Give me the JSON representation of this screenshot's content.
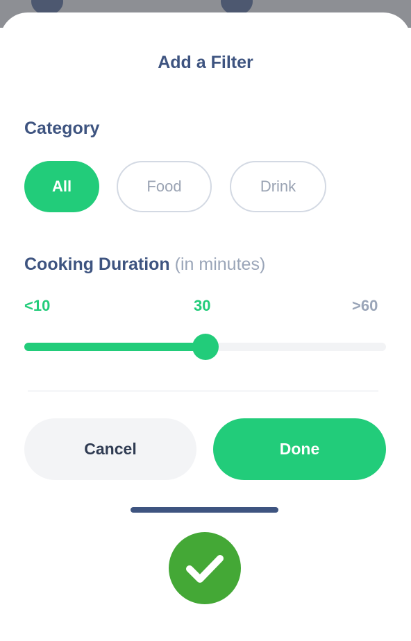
{
  "title": "Add a Filter",
  "category": {
    "label": "Category",
    "options": [
      {
        "label": "All",
        "selected": true
      },
      {
        "label": "Food",
        "selected": false
      },
      {
        "label": "Drink",
        "selected": false
      }
    ]
  },
  "duration": {
    "label": "Cooking Duration",
    "unit_note": "(in minutes)",
    "min_label": "<10",
    "current_label": "30",
    "max_label": ">60",
    "value": 30,
    "min_value": 10,
    "max_value": 60,
    "fill_fraction": 0.5
  },
  "actions": {
    "cancel_label": "Cancel",
    "done_label": "Done"
  },
  "colors": {
    "accent": "#22cc7a",
    "heading": "#3e5480",
    "muted": "#9aa5b8",
    "success_badge": "#44a836"
  },
  "icons": {
    "success": "checkmark-icon"
  }
}
